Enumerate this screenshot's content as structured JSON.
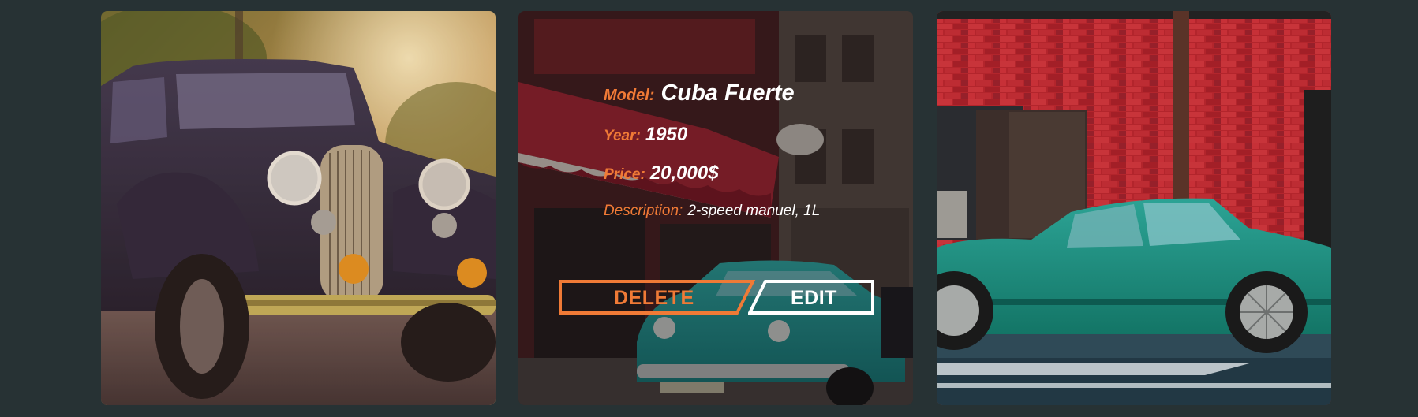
{
  "gallery": {
    "cards": [
      {
        "alt": "Vintage black car with chrome grille at sunset"
      },
      {
        "alt": "Teal classic car on a Havana street",
        "details": {
          "model_label": "Model:",
          "model_value": "Cuba Fuerte",
          "year_label": "Year:",
          "year_value": "1950",
          "price_label": "Price:",
          "price_value": "20,000$",
          "description_label": "Description:",
          "description_value": "2-speed manuel, 1L"
        },
        "actions": {
          "delete_label": "DELETE",
          "edit_label": "EDIT"
        }
      },
      {
        "alt": "Teal sedan parked in front of a red brick wall"
      }
    ]
  },
  "colors": {
    "page_background": "#273234",
    "accent_orange": "#f07a36",
    "text_white": "#ffffff"
  }
}
